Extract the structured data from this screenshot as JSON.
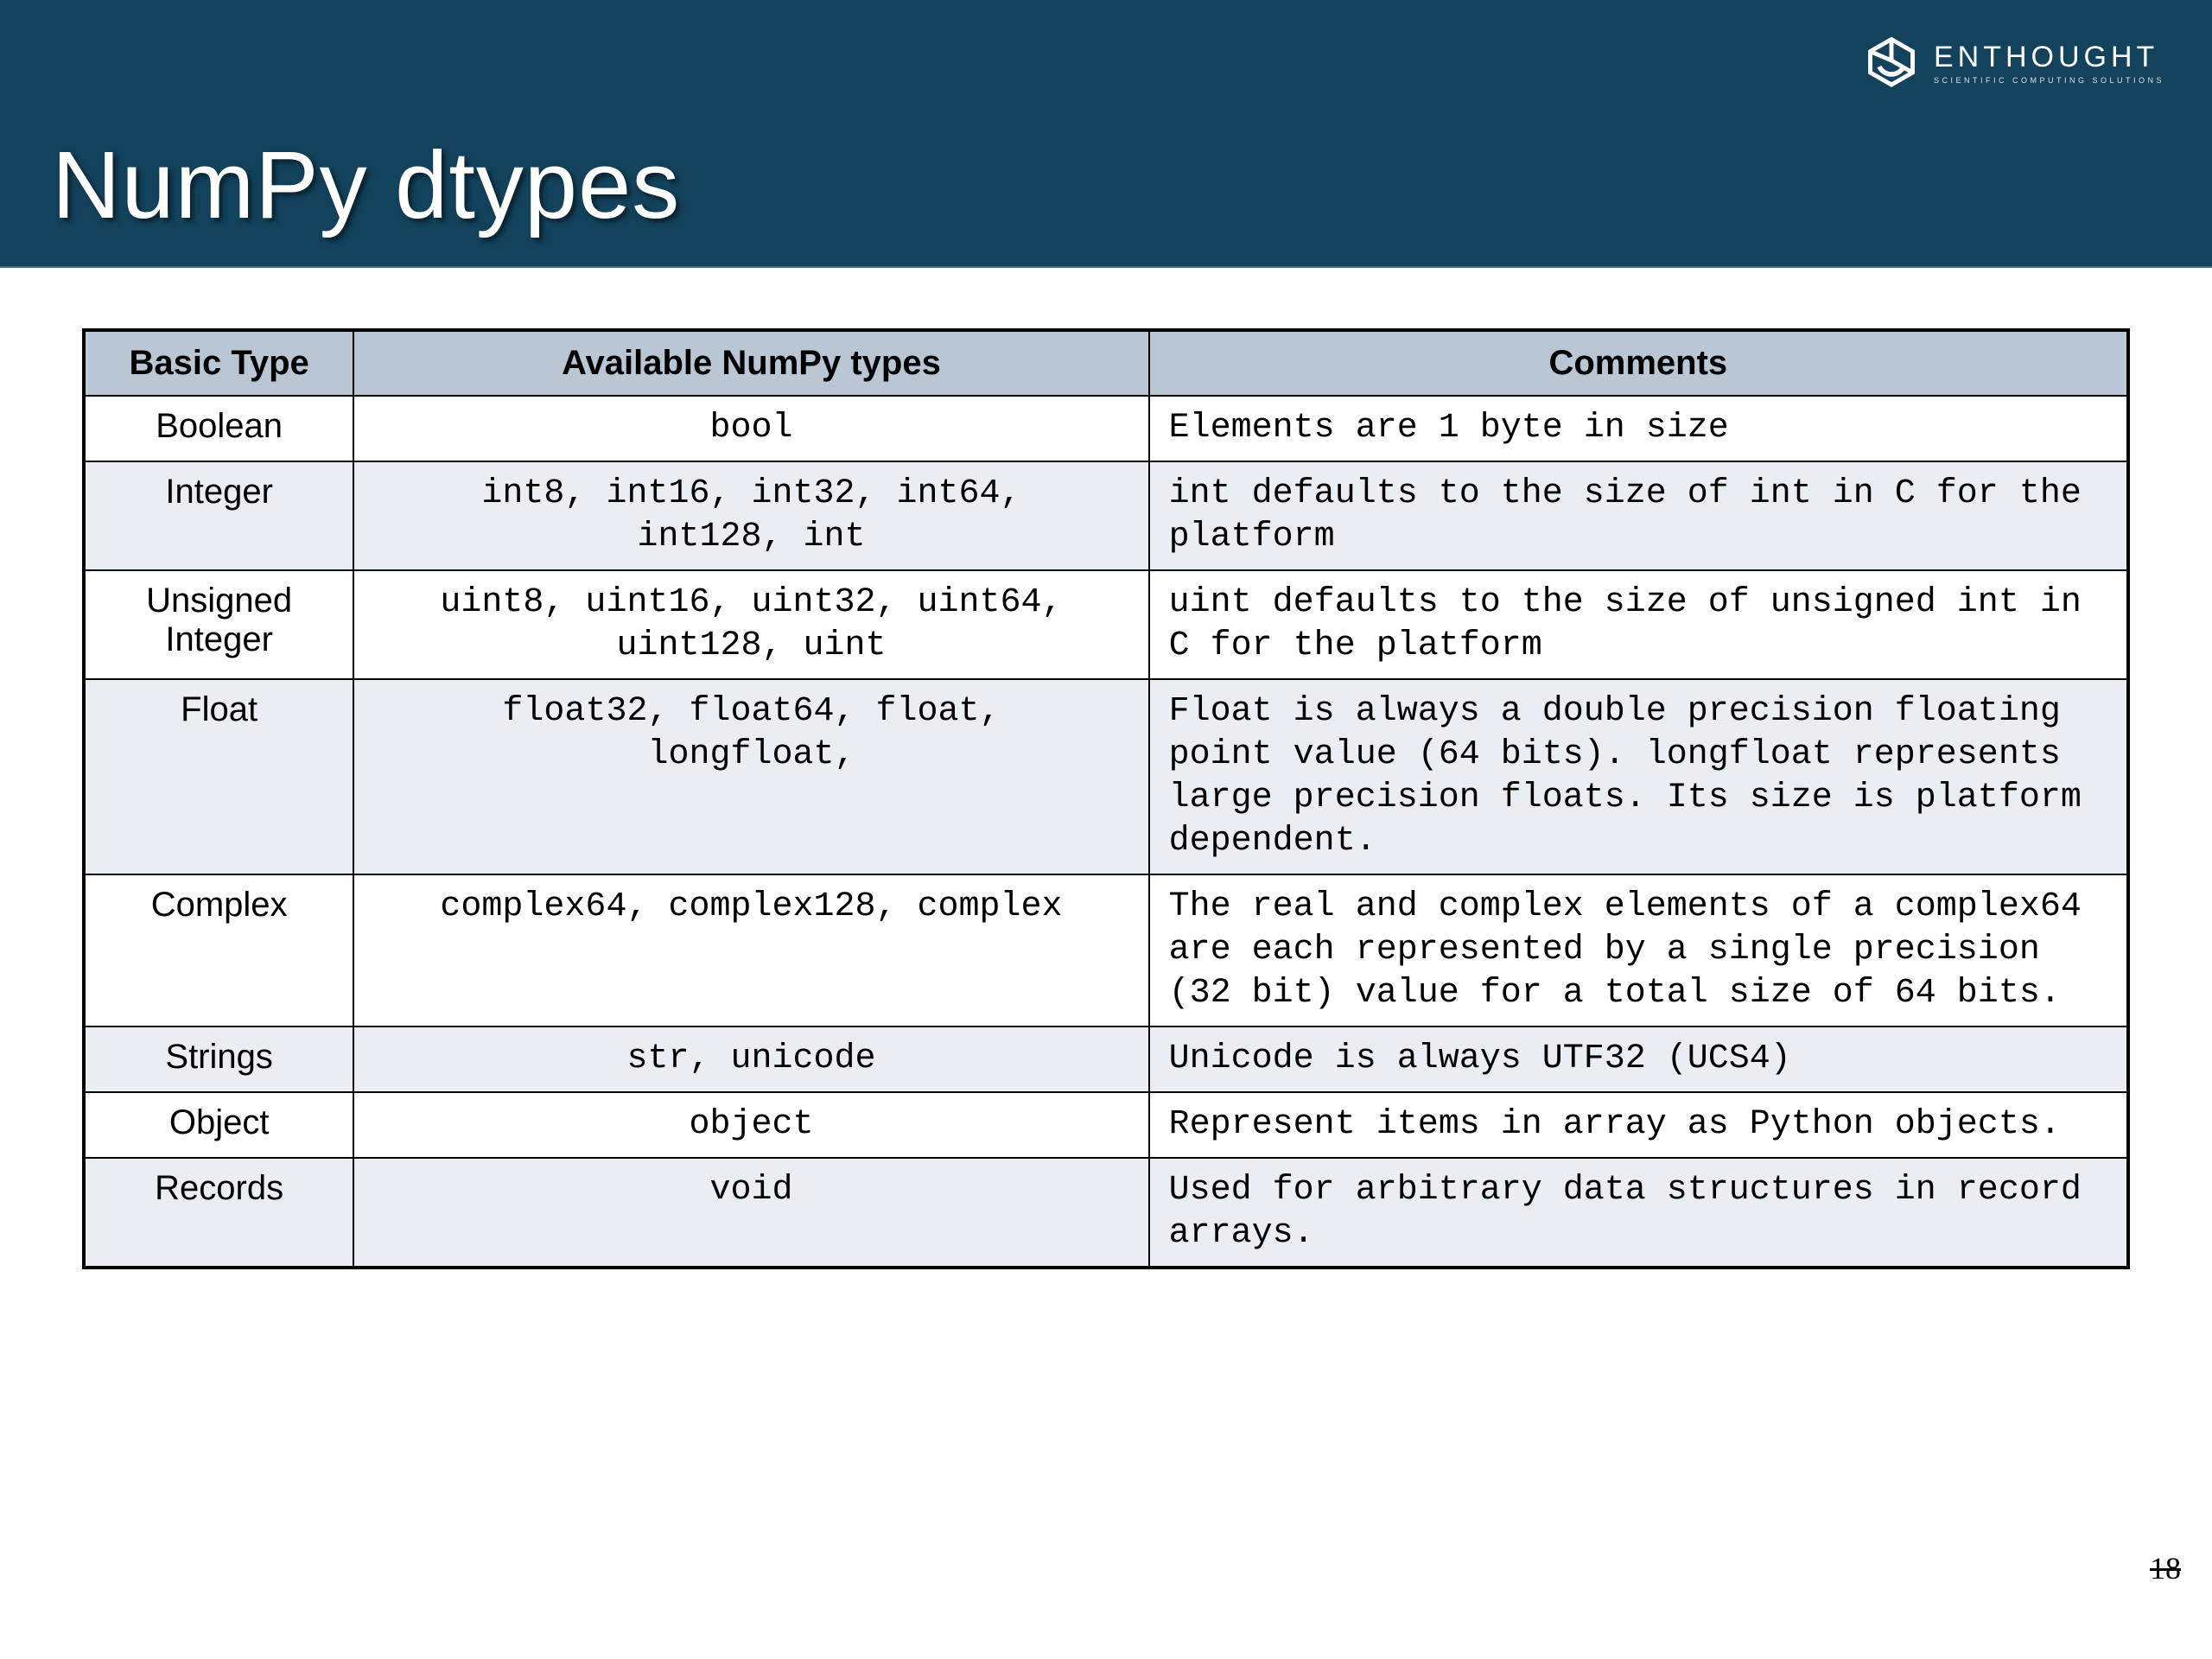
{
  "header": {
    "title": "NumPy dtypes",
    "brand": "ENTHOUGHT",
    "tagline": "SCIENTIFIC COMPUTING SOLUTIONS"
  },
  "table": {
    "headers": {
      "basic": "Basic Type",
      "types": "Available NumPy types",
      "comments": "Comments"
    },
    "rows": [
      {
        "basic": "Boolean",
        "types": "bool",
        "comments": "Elements are 1 byte in size",
        "shade": false
      },
      {
        "basic": "Integer",
        "types": "int8, int16, int32, int64,\nint128, int",
        "comments": "int defaults to the size of int in C for the platform",
        "shade": true
      },
      {
        "basic": "Unsigned Integer",
        "types": "uint8, uint16, uint32, uint64,\nuint128, uint",
        "comments": "uint defaults to the size of unsigned int in C for the platform",
        "shade": false
      },
      {
        "basic": "Float",
        "types": "float32, float64, float,\nlongfloat,",
        "comments": "Float is always a double precision floating point value (64 bits). longfloat represents large precision floats.  Its size is platform dependent.",
        "shade": true
      },
      {
        "basic": "Complex",
        "types": "complex64, complex128, complex",
        "comments": "The real and complex elements of a complex64 are each represented by a single precision (32 bit) value for a total size of 64 bits.",
        "shade": false
      },
      {
        "basic": "Strings",
        "types": "str, unicode",
        "comments": "Unicode is always UTF32 (UCS4)",
        "shade": true
      },
      {
        "basic": "Object",
        "types": "object",
        "comments": "Represent items in array as Python objects.",
        "shade": false
      },
      {
        "basic": "Records",
        "types": "void",
        "comments": "Used for arbitrary data structures in record arrays.",
        "shade": true
      }
    ]
  },
  "page_number": "18"
}
